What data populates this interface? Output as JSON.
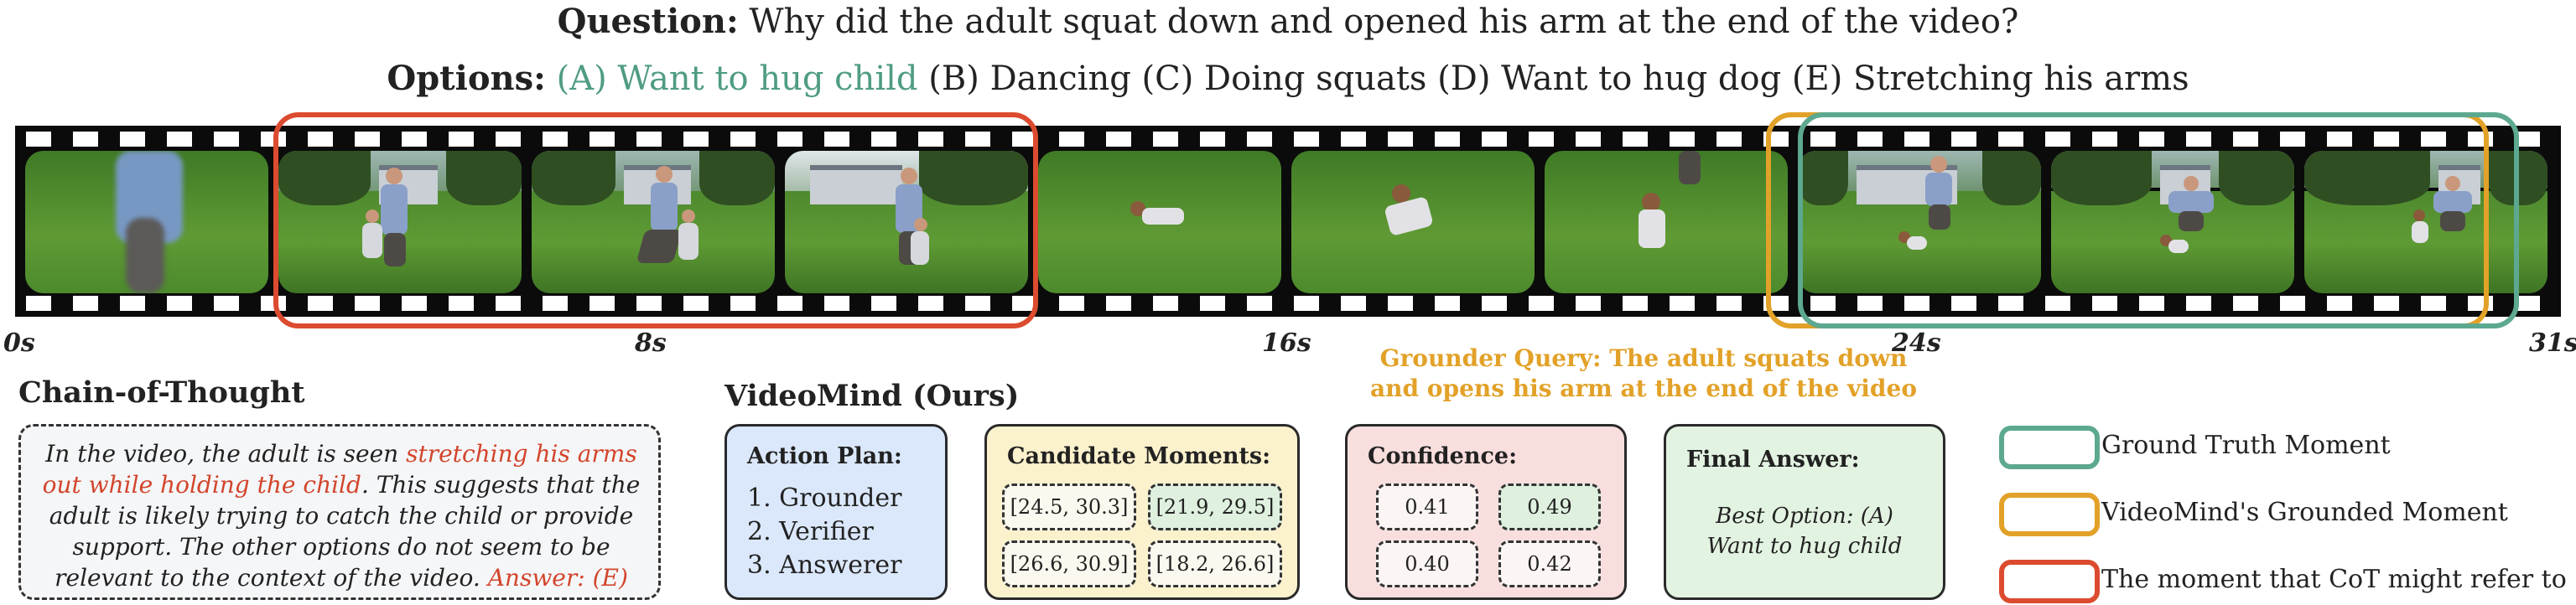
{
  "question": {
    "label": "Question:",
    "text": "Why did the adult squat down and opened his arm at the end of the video?"
  },
  "options": {
    "label": "Options:",
    "a": "(A) Want to hug child",
    "rest": "(B) Dancing (C) Doing squats (D) Want to hug dog (E) Stretching his arms"
  },
  "timeline": {
    "labels": [
      "0s",
      "8s",
      "16s",
      "24s",
      "31s"
    ]
  },
  "grounder_query": {
    "line1": "Grounder Query: The adult squats down",
    "line2": "and opens his arm at the end of the video"
  },
  "cot": {
    "heading": "Chain-of-Thought",
    "t1": "In the video, the adult is seen ",
    "t2": "stretching his arms out while holding the child",
    "t3": ". This suggests that the adult is likely trying to catch the child or provide support. The other options do not seem to be relevant to the context of the video. ",
    "t4": "Answer: (E)"
  },
  "videomind": {
    "heading": "VideoMind (Ours)",
    "action_plan": {
      "title": "Action Plan:",
      "items": [
        "1. Grounder",
        "2. Verifier",
        "3. Answerer"
      ]
    },
    "candidates": {
      "title": "Candidate Moments:",
      "items": [
        "[24.5, 30.3]",
        "[21.9, 29.5]",
        "[26.6, 30.9]",
        "[18.2, 26.6]"
      ]
    },
    "confidence": {
      "title": "Confidence:",
      "items": [
        "0.41",
        "0.49",
        "0.40",
        "0.42"
      ]
    },
    "final": {
      "title": "Final Answer:",
      "line1": "Best Option: (A)",
      "line2": "Want to hug child"
    }
  },
  "legend": {
    "items": [
      "Ground Truth Moment",
      "VideoMind's Grounded Moment",
      "The moment that CoT might refer to"
    ]
  },
  "colors": {
    "ground_truth": "#5da890",
    "videomind": "#e2a128",
    "cot": "#dc4b2f",
    "action_plan_bg": "#dbe8fb",
    "candidates_bg": "#fbf1cc",
    "confidence_bg": "#f9dede",
    "final_bg": "#e3f3e2"
  }
}
